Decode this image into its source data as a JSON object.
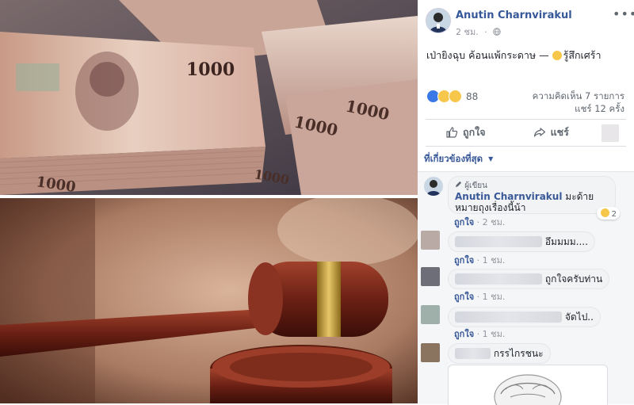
{
  "post": {
    "author": "Anutin Charnvirakul",
    "time": "2 ชม.",
    "menu_icon": "•••",
    "text": "เป่ายิงฉุบ ค้อนแพ้กระดาษ — ",
    "feeling": "รู้สึกเศร้า",
    "reaction_count": "88",
    "comments_count": "ความคิดเห็น 7 รายการ",
    "shares_count": "แชร์ 12 ครั้ง",
    "like_label": "ถูกใจ",
    "share_label": "แชร์"
  },
  "sort_label": "ที่เกี่ยวข้องที่สุด",
  "comments": [
    {
      "badge": "ผู้เขียน",
      "author": "Anutin Charnvirakul",
      "text": "มะด้ายหมายถุงเรื่องนี้น้า",
      "like": "ถูกใจ",
      "time": "2 ชม.",
      "reactions": "2"
    },
    {
      "text": "อึมมมม....",
      "like": "ถูกใจ",
      "time": "1 ชม."
    },
    {
      "text": "ถูกใจครับท่าน",
      "like": "ถูกใจ",
      "time": "1 ชม."
    },
    {
      "text": "จัดไป..",
      "like": "ถูกใจ",
      "time": "1 ชม."
    },
    {
      "text": "กรรไกรชนะ"
    }
  ],
  "images": {
    "money_note": "1000"
  }
}
